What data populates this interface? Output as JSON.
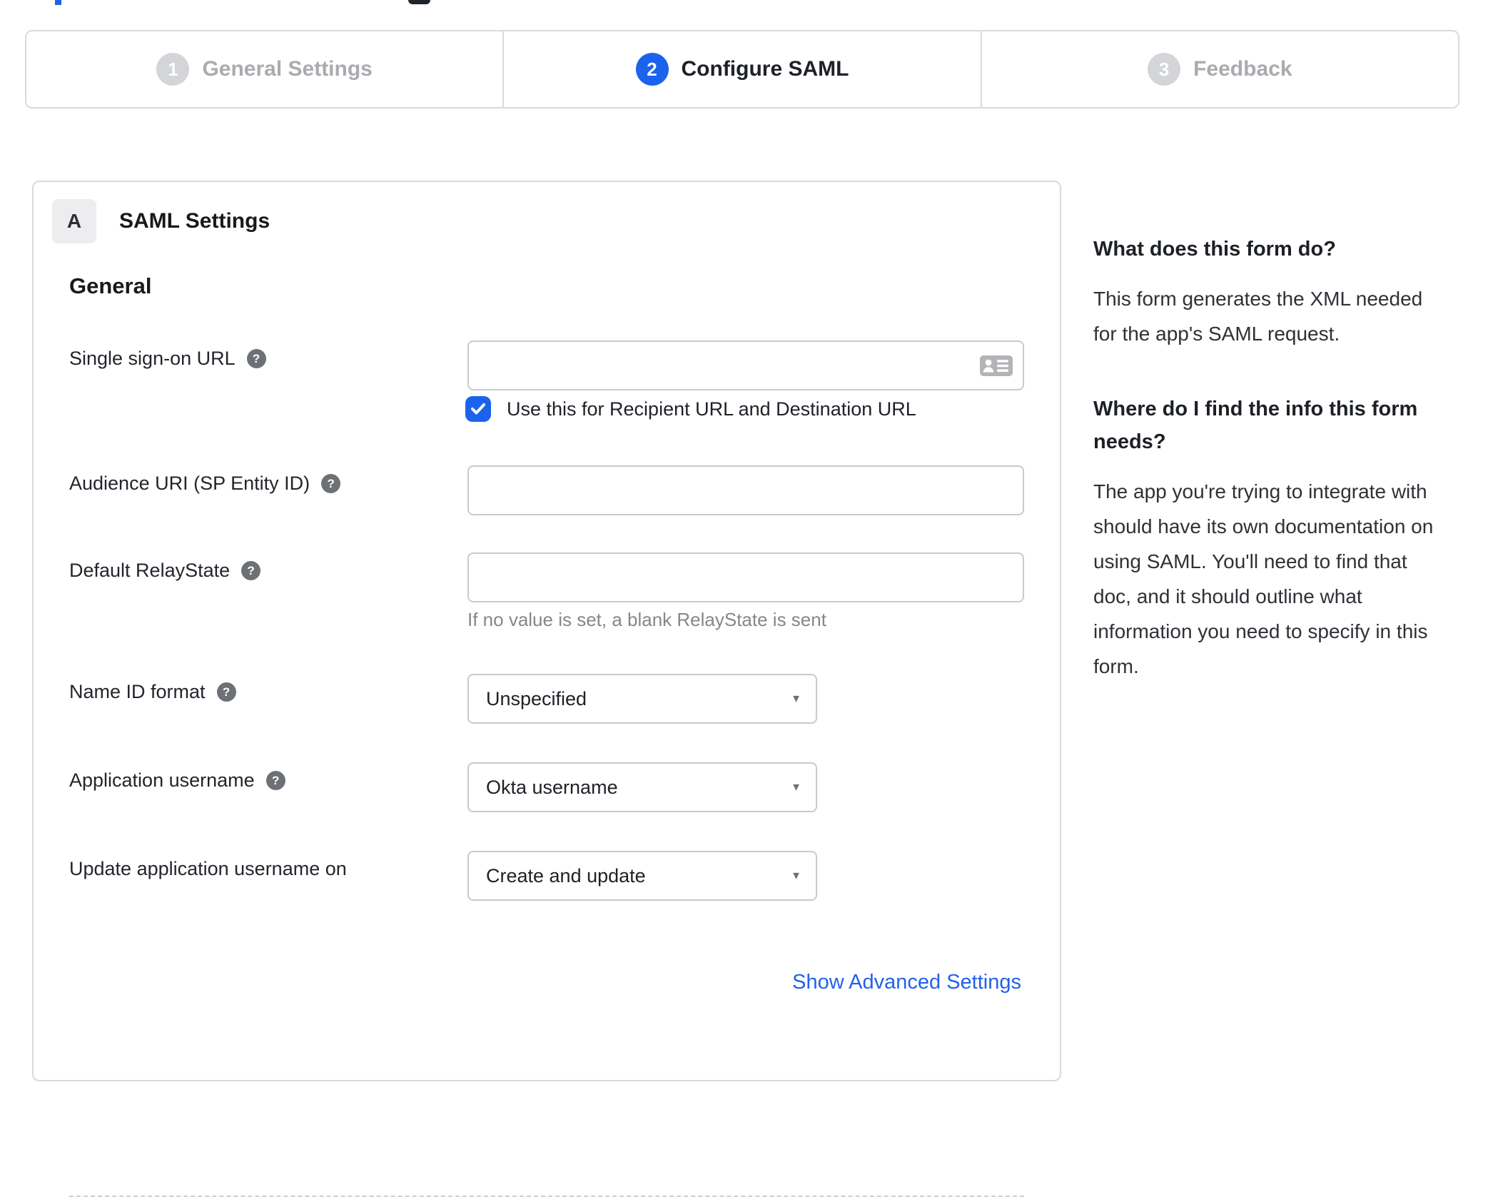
{
  "artifacts": {
    "blue_fragment": "cut-off blue element at top of page",
    "dark_fragment": "cut-off dark element at top of page"
  },
  "colors": {
    "primary_blue": "#1b63ec",
    "link_blue": "#2361ea",
    "border_gray": "#d9dadb",
    "inactive_gray": "#a9abaf",
    "text_dark": "#1e2127",
    "hint_gray": "#85878b"
  },
  "stepper": {
    "steps": [
      {
        "number": "1",
        "label": "General Settings",
        "state": "inactive"
      },
      {
        "number": "2",
        "label": "Configure SAML",
        "state": "active"
      },
      {
        "number": "3",
        "label": "Feedback",
        "state": "inactive"
      }
    ]
  },
  "panel": {
    "badge": "A",
    "title": "SAML Settings",
    "section_heading": "General",
    "fields": {
      "sso_url": {
        "label": "Single sign-on URL",
        "value": "",
        "checkbox_label": "Use this for Recipient URL and Destination URL",
        "checkbox_checked": true
      },
      "audience_uri": {
        "label": "Audience URI (SP Entity ID)",
        "value": ""
      },
      "relay_state": {
        "label": "Default RelayState",
        "value": "",
        "hint": "If no value is set, a blank RelayState is sent"
      },
      "name_id_format": {
        "label": "Name ID format",
        "selected": "Unspecified"
      },
      "application_username": {
        "label": "Application username",
        "selected": "Okta username"
      },
      "update_application_username": {
        "label": "Update application username on",
        "selected": "Create and update"
      }
    },
    "advanced_link": "Show Advanced Settings"
  },
  "sidebar": {
    "section1": {
      "heading": "What does this form do?",
      "body": "This form generates the XML needed\nfor the app's SAML request."
    },
    "section2": {
      "heading": "Where do I find the info this form\nneeds?",
      "body": "The app you're trying to integrate with\nshould have its own documentation on\nusing SAML. You'll need to find that\ndoc, and it should outline what\ninformation you need to specify in this\nform."
    }
  },
  "glyphs": {
    "help": "?",
    "caret": "▼"
  }
}
